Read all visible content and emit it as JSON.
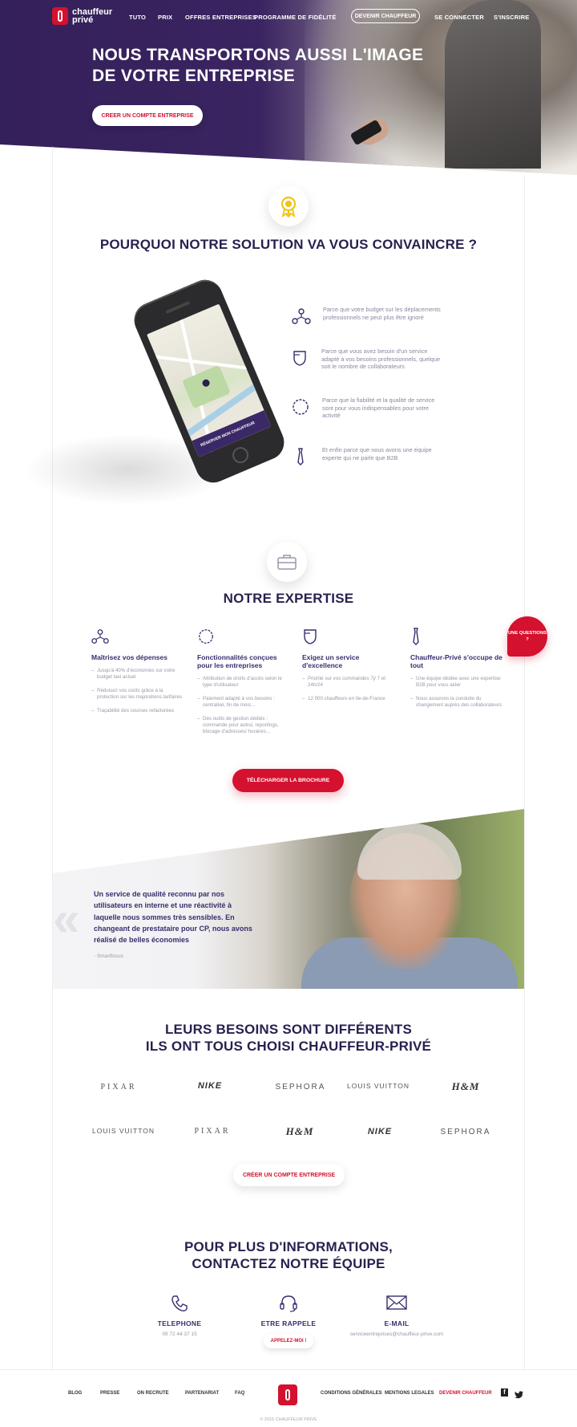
{
  "header": {
    "logo_text": "chauffeur privé",
    "nav": [
      "TUTO",
      "PRIX",
      "OFFRES ENTREPRISES",
      "PROGRAMME DE FIDÉLITÉ"
    ],
    "become_driver": "DEVENIR CHAUFFEUR",
    "login": "SE CONNECTER",
    "signup": "S'INSCRIRE"
  },
  "hero": {
    "title": "NOUS TRANSPORTONS AUSSI L'IMAGE DE VOTRE ENTREPRISE",
    "cta": "CREER UN COMPTE ENTREPRISE"
  },
  "why": {
    "title": "POURQUOI NOTRE SOLUTION VA VOUS CONVAINCRE ?",
    "reasons": [
      {
        "icon": "budget-icon",
        "text": "Parce que votre budget sur les déplacements professionnels ne peut plus être ignoré"
      },
      {
        "icon": "shield-icon",
        "text": "Parce que vous avez besoin d'un service adapté à vos besoins professionnels, quelque soit le nombre de collaborateurs"
      },
      {
        "icon": "reliability-icon",
        "text": "Parce que la fiabilité et la qualité de service sont pour vous indispensables pour votre activité"
      },
      {
        "icon": "tie-icon",
        "text": "Et enfin parce que nous avons une équipe experte qui ne parle que B2B"
      }
    ],
    "phone_button": "RÉSERVER MON CHAUFFEUR"
  },
  "expertise": {
    "title": "NOTRE EXPERTISE",
    "columns": [
      {
        "title": "Maîtrisez vos dépenses",
        "items": [
          "Jusqu'à 40% d'économies sur votre budget taxi actuel",
          "Réduisez vos coûts grâce à la protection sur les majorations tarifaires",
          "Traçabilité des courses refacturées"
        ]
      },
      {
        "title": "Fonctionnalités conçues pour les entreprises",
        "items": [
          "Attribution de droits d'accès selon le type d'utilisateur",
          "Paiement adapté à vos besoins : centralisé, fin de mois…",
          "Des outils de gestion dédiés : commande pour autrui, reportings, blocage d'adresses/ horaires…"
        ]
      },
      {
        "title": "Exigez un service d'excellence",
        "items": [
          "Priorité sur vos commandes 7j/ 7 et 24h/24",
          "12 000 chauffeurs en Ile-de-France"
        ]
      },
      {
        "title": "Chauffeur-Privé s'occupe de tout",
        "items": [
          "Une équipe dédiée avec une expertise B2B pour vous aider",
          "Nous assurons la conduite du changement auprès des collaborateurs"
        ]
      }
    ],
    "questions": "UNE QUESTIONS ?",
    "brochure": "TÉLÉCHARGER LA BROCHURE"
  },
  "testimonial": {
    "quote": "Un service de qualité reconnu par nos utilisateurs en interne et une réactivité à laquelle nous sommes très sensibles. En changeant de prestataire pour CP, nous avons réalisé de belles économies",
    "source": "- Smartfocus"
  },
  "clients": {
    "title_line1": "LEURS BESOINS SONT DIFFÉRENTS",
    "title_line2": "ILS ONT TOUS CHOISI CHAUFFEUR-PRIVÉ",
    "row1": [
      "PIXAR",
      "NIKE",
      "SEPHORA",
      "LOUIS VUITTON",
      "H&M"
    ],
    "row2": [
      "LOUIS VUITTON",
      "PIXAR",
      "H&M",
      "NIKE",
      "SEPHORA"
    ],
    "cta": "CRÉER UN COMPTE ENTREPRISE"
  },
  "contact": {
    "title_line1": "POUR PLUS D'INFORMATIONS,",
    "title_line2": "CONTACTEZ NOTRE ÉQUIPE",
    "phone_title": "TELEPHONE",
    "phone_value": "09 72 44 37 15",
    "callback_title": "ETRE RAPPELE",
    "callback_button": "APPELEZ-MOI !",
    "email_title": "E-MAIL",
    "email_value": "serviceentreprises@chauffeur-prive.com"
  },
  "footer": {
    "links": [
      "BLOG",
      "PRESSE",
      "ON RECRUTE",
      "PARTENARIAT",
      "FAQ"
    ],
    "links_right": [
      "CONDITIONS GÉNÉRALES",
      "MENTIONS LEGALES"
    ],
    "become_driver": "DEVENIR CHAUFFEUR",
    "copyright": "© 2016 CHAUFFEUR PRIVE"
  },
  "colors": {
    "primary": "#2a1f4f",
    "accent": "#d4112e",
    "hero_bg": "#34205a"
  }
}
